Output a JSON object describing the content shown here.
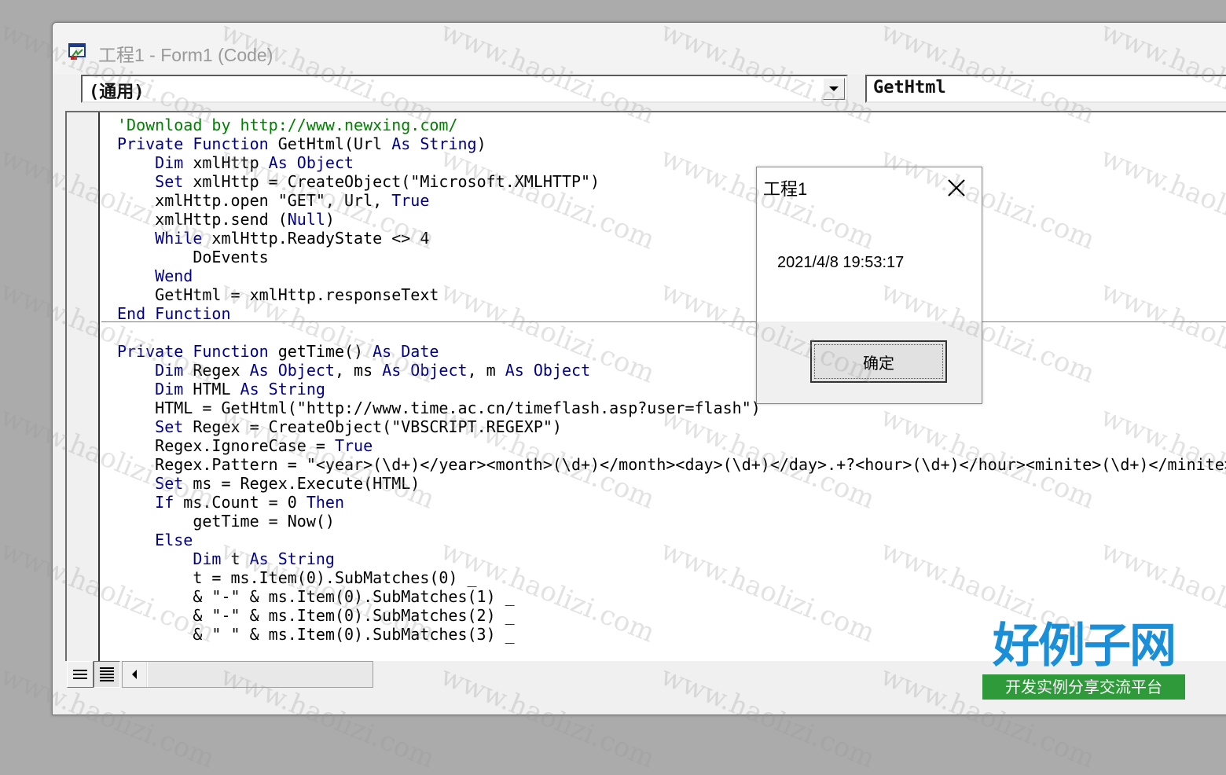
{
  "window": {
    "title": "工程1 - Form1 (Code)"
  },
  "object_combo": {
    "value": "(通用)"
  },
  "procedure_combo": {
    "value": "GetHtml"
  },
  "code_lines": [
    [
      {
        "t": "'Download by http://www.newxing.com/",
        "c": "cm"
      }
    ],
    [
      {
        "t": "Private Function",
        "c": "kw"
      },
      {
        "t": " GetHtml(Url ",
        "c": ""
      },
      {
        "t": "As String",
        "c": "kw"
      },
      {
        "t": ")",
        "c": ""
      }
    ],
    [
      {
        "t": "    ",
        "c": ""
      },
      {
        "t": "Dim",
        "c": "kw"
      },
      {
        "t": " xmlHttp ",
        "c": ""
      },
      {
        "t": "As Object",
        "c": "kw"
      }
    ],
    [
      {
        "t": "    ",
        "c": ""
      },
      {
        "t": "Set",
        "c": "kw"
      },
      {
        "t": " xmlHttp = CreateObject(\"Microsoft.XMLHTTP\")",
        "c": ""
      }
    ],
    [
      {
        "t": "    xmlHttp.open \"GET\", Url, ",
        "c": ""
      },
      {
        "t": "True",
        "c": "kw"
      }
    ],
    [
      {
        "t": "    xmlHttp.send (",
        "c": ""
      },
      {
        "t": "Null",
        "c": "kw"
      },
      {
        "t": ")",
        "c": ""
      }
    ],
    [
      {
        "t": "    ",
        "c": ""
      },
      {
        "t": "While",
        "c": "kw"
      },
      {
        "t": " xmlHttp.ReadyState <> 4",
        "c": ""
      }
    ],
    [
      {
        "t": "        DoEvents",
        "c": ""
      }
    ],
    [
      {
        "t": "    ",
        "c": ""
      },
      {
        "t": "Wend",
        "c": "kw"
      }
    ],
    [
      {
        "t": "    GetHtml = xmlHttp.responseText",
        "c": ""
      }
    ],
    [
      {
        "t": "End Function",
        "c": "kw"
      }
    ],
    [
      {
        "t": "",
        "c": ""
      }
    ],
    [
      {
        "t": "Private Function",
        "c": "kw"
      },
      {
        "t": " getTime() ",
        "c": ""
      },
      {
        "t": "As Date",
        "c": "kw"
      }
    ],
    [
      {
        "t": "    ",
        "c": ""
      },
      {
        "t": "Dim",
        "c": "kw"
      },
      {
        "t": " Regex ",
        "c": ""
      },
      {
        "t": "As Object",
        "c": "kw"
      },
      {
        "t": ", ms ",
        "c": ""
      },
      {
        "t": "As Object",
        "c": "kw"
      },
      {
        "t": ", m ",
        "c": ""
      },
      {
        "t": "As Object",
        "c": "kw"
      }
    ],
    [
      {
        "t": "    ",
        "c": ""
      },
      {
        "t": "Dim",
        "c": "kw"
      },
      {
        "t": " HTML ",
        "c": ""
      },
      {
        "t": "As String",
        "c": "kw"
      }
    ],
    [
      {
        "t": "    HTML = GetHtml(\"http://www.time.ac.cn/timeflash.asp?user=flash\")",
        "c": ""
      }
    ],
    [
      {
        "t": "    ",
        "c": ""
      },
      {
        "t": "Set",
        "c": "kw"
      },
      {
        "t": " Regex = CreateObject(\"VBSCRIPT.REGEXP\")",
        "c": ""
      }
    ],
    [
      {
        "t": "    Regex.IgnoreCase = ",
        "c": ""
      },
      {
        "t": "True",
        "c": "kw"
      }
    ],
    [
      {
        "t": "    Regex.Pattern = \"<year>(\\d+)</year><month>(\\d+)</month><day>(\\d+)</day>.+?<hour>(\\d+)</hour><minite>(\\d+)</minite>",
        "c": ""
      }
    ],
    [
      {
        "t": "    ",
        "c": ""
      },
      {
        "t": "Set",
        "c": "kw"
      },
      {
        "t": " ms = Regex.Execute(HTML)",
        "c": ""
      }
    ],
    [
      {
        "t": "    ",
        "c": ""
      },
      {
        "t": "If",
        "c": "kw"
      },
      {
        "t": " ms.Count = 0 ",
        "c": ""
      },
      {
        "t": "Then",
        "c": "kw"
      }
    ],
    [
      {
        "t": "        getTime = Now()",
        "c": ""
      }
    ],
    [
      {
        "t": "    ",
        "c": ""
      },
      {
        "t": "Else",
        "c": "kw"
      }
    ],
    [
      {
        "t": "        ",
        "c": ""
      },
      {
        "t": "Dim",
        "c": "kw"
      },
      {
        "t": " t ",
        "c": ""
      },
      {
        "t": "As String",
        "c": "kw"
      }
    ],
    [
      {
        "t": "        t = ms.Item(0).SubMatches(0) _",
        "c": ""
      }
    ],
    [
      {
        "t": "        & \"-\" & ms.Item(0).SubMatches(1) _",
        "c": ""
      }
    ],
    [
      {
        "t": "        & \"-\" & ms.Item(0).SubMatches(2) _",
        "c": ""
      }
    ],
    [
      {
        "t": "        & \" \" & ms.Item(0).SubMatches(3) _",
        "c": ""
      }
    ]
  ],
  "msgbox": {
    "title": "工程1",
    "message": "2021/4/8 19:53:17",
    "ok_label": "确定"
  },
  "brand": {
    "name": "好例子网",
    "tagline": "开发实例分享交流平台"
  },
  "watermark_text": "www.haolizi.com",
  "colors": {
    "keyword": "#00008b",
    "comment": "#008000",
    "brand_blue": "#1a8fd8",
    "brand_green": "#2e9a3a"
  }
}
